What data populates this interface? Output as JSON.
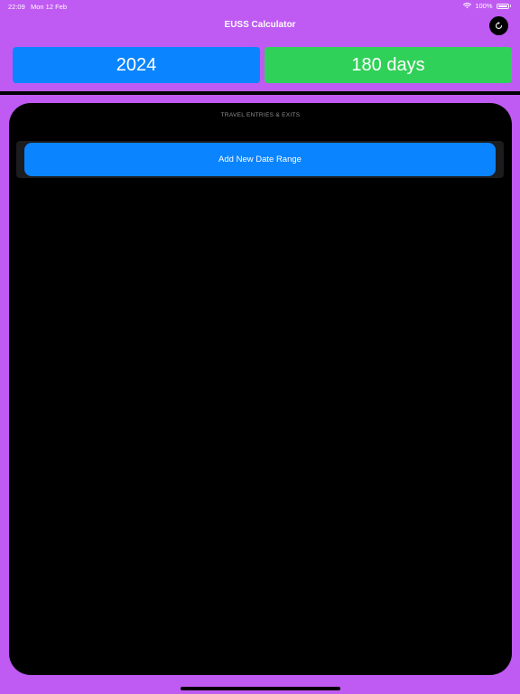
{
  "status_bar": {
    "time": "22:09",
    "date": "Mon 12 Feb",
    "battery": "100%",
    "icons": [
      "wifi-icon",
      "battery-icon"
    ]
  },
  "nav": {
    "title": "EUSS Calculator",
    "refresh_icon": "refresh-icon"
  },
  "summary": {
    "year": "2024",
    "days": "180 days"
  },
  "entries": {
    "header": "TRAVEL ENTRIES & EXITS",
    "add_label": "Add New Date Range"
  },
  "colors": {
    "background": "#BF5AF2",
    "year_tile": "#0A84FF",
    "days_tile": "#30D158",
    "panel": "#000000",
    "list_group": "#1C1C1E",
    "add_button": "#0A84FF",
    "section_header": "#8E8E93"
  }
}
